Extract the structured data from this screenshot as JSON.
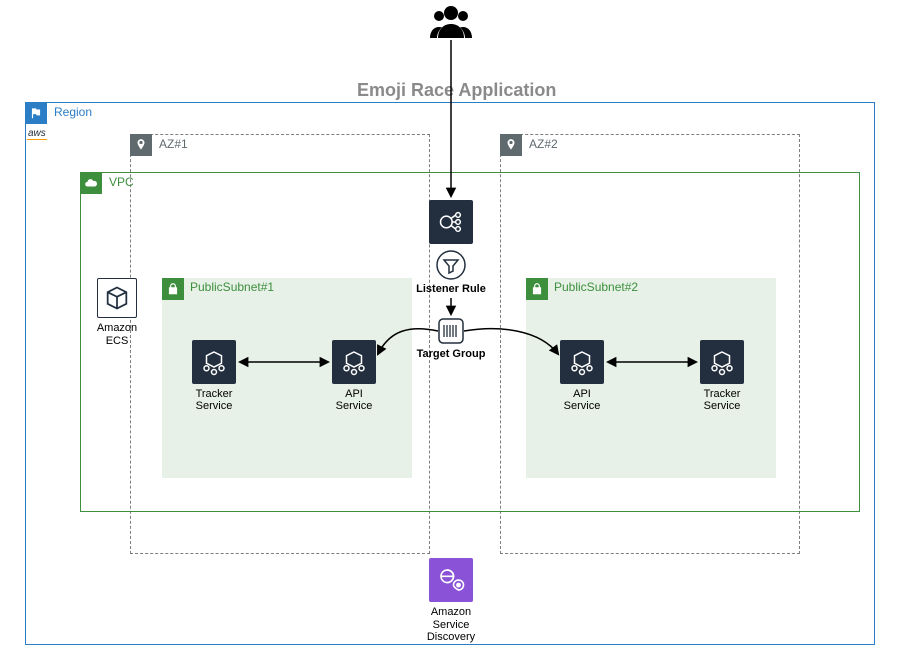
{
  "title": "Emoji Race Application",
  "region": {
    "label": "Region"
  },
  "aws_mark": "aws",
  "vpc": {
    "label": "VPC"
  },
  "az1": {
    "label": "AZ#1"
  },
  "az2": {
    "label": "AZ#2"
  },
  "subnet1": {
    "label": "PublicSubnet#1"
  },
  "subnet2": {
    "label": "PublicSubnet#2"
  },
  "ecs": {
    "label": "Amazon\nECS"
  },
  "elb": {
    "label": ""
  },
  "listener": {
    "label": "Listener Rule"
  },
  "targetgroup": {
    "label": "Target Group"
  },
  "svc_discovery": {
    "label": "Amazon\nService\nDiscovery"
  },
  "s1_tracker": {
    "label": "Tracker\nService"
  },
  "s1_api": {
    "label": "API\nService"
  },
  "s2_api": {
    "label": "API\nService"
  },
  "s2_tracker": {
    "label": "Tracker\nService"
  }
}
